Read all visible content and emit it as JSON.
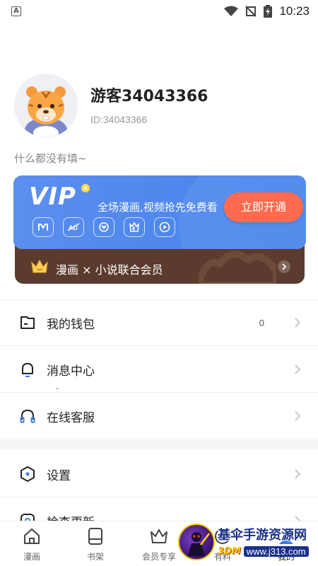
{
  "status_bar": {
    "left_icon": "A",
    "time": "10:23",
    "icons": [
      "wifi-icon",
      "no-signal-icon",
      "battery-charging-icon"
    ]
  },
  "profile": {
    "username": "游客34043366",
    "user_id": "ID:34043366",
    "bio": "什么都没有填~",
    "avatar": "tiger-avatar"
  },
  "vip_card": {
    "logo": "VIP",
    "description": "全场漫画,视频抢先免费看",
    "cta": "立即开通",
    "perk_icons": [
      "manga-perk-icon",
      "ad-free-perk-icon",
      "heart-perk-icon",
      "badge-perk-icon",
      "play-perk-icon"
    ],
    "bundle_label": "漫画 × 小说联合会员",
    "colors": {
      "card": "#4f87ec",
      "cta": "#ff6b4e",
      "bundle": "#5a3b2e"
    }
  },
  "menu": [
    {
      "label": "我的钱包",
      "value": "0",
      "icon": "wallet-icon"
    },
    {
      "label": "消息中心",
      "value": "",
      "icon": "bell-icon"
    },
    {
      "label": "在线客服",
      "value": "",
      "icon": "headset-icon"
    },
    {
      "label": "设置",
      "value": "",
      "icon": "settings-hexagon-icon"
    },
    {
      "label": "检查更新",
      "value": "",
      "icon": "update-icon"
    }
  ],
  "tab_bar": {
    "tabs": [
      {
        "label": "漫画",
        "icon": "home-icon"
      },
      {
        "label": "书架",
        "icon": "bookshelf-icon"
      },
      {
        "label": "会员专享",
        "icon": "crown-icon"
      },
      {
        "label": "有料",
        "icon": "discover-icon"
      },
      {
        "label": "我的",
        "icon": "profile-icon"
      }
    ],
    "active": "我的"
  },
  "watermark": {
    "title": "基伞手游资源网",
    "url": "www.j313.com"
  }
}
